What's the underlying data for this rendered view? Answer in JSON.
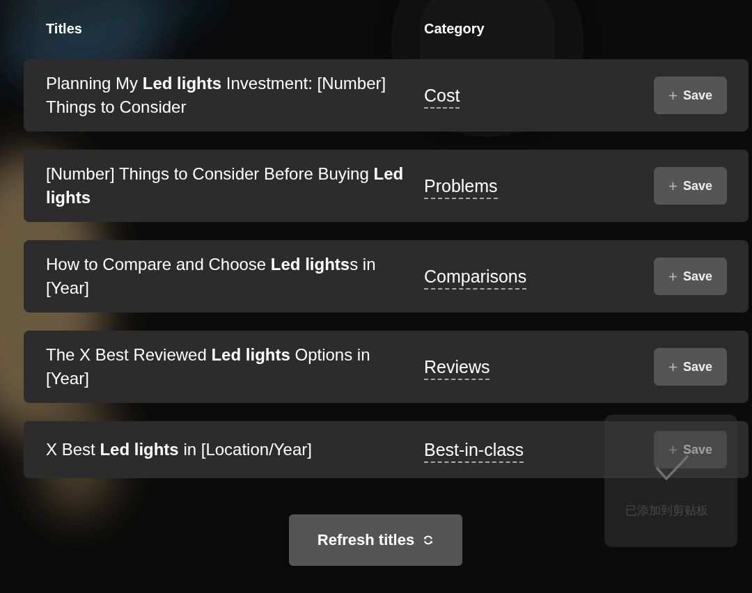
{
  "headers": {
    "titles": "Titles",
    "category": "Category"
  },
  "rows": [
    {
      "title": "Planning My **Led lights** Investment: [Number] Things to Consider",
      "category": "Cost",
      "button": "Save"
    },
    {
      "title": "[Number] Things to Consider Before Buying **Led lights**",
      "category": "Problems",
      "button": "Save"
    },
    {
      "title": "How to Compare and Choose **Led lights**s in [Year]",
      "category": "Comparisons",
      "button": "Save"
    },
    {
      "title": "The X Best Reviewed **Led lights** Options in [Year]",
      "category": "Reviews",
      "button": "Save"
    },
    {
      "title": "X Best **Led lights** in [Location/Year]",
      "category": "Best-in-class",
      "button": "Save"
    }
  ],
  "toast": {
    "text": "已添加到剪贴板"
  },
  "refresh_button": "Refresh titles"
}
